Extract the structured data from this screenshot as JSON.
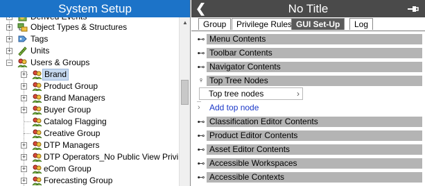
{
  "left_panel": {
    "title": "System Setup",
    "tree": [
      {
        "label": "Derived Events",
        "icon": "derived-events-icon"
      },
      {
        "label": "Object Types & Structures",
        "icon": "object-types-icon"
      },
      {
        "label": "Tags",
        "icon": "tag-icon"
      },
      {
        "label": "Units",
        "icon": "ruler-icon"
      },
      {
        "label": "Users & Groups",
        "icon": "users-icon"
      },
      {
        "label": "Brand",
        "icon": "users-icon"
      },
      {
        "label": "Product Group",
        "icon": "users-icon"
      },
      {
        "label": "Brand Managers",
        "icon": "users-icon"
      },
      {
        "label": "Buyer Group",
        "icon": "users-icon"
      },
      {
        "label": "Catalog Flagging",
        "icon": "users-icon"
      },
      {
        "label": "Creative Group",
        "icon": "users-icon"
      },
      {
        "label": "DTP Managers",
        "icon": "users-icon"
      },
      {
        "label": "DTP Operators_No Public View Privileges",
        "icon": "users-icon"
      },
      {
        "label": "eCom Group",
        "icon": "users-icon"
      },
      {
        "label": "Forecasting Group",
        "icon": "users-icon"
      }
    ],
    "selected": "Brand"
  },
  "right_panel": {
    "title": "No Title",
    "back_icon": "back-arrow-icon",
    "pin_icon": "pin-icon",
    "tabs": [
      {
        "label": "Group"
      },
      {
        "label": "Privilege Rules"
      },
      {
        "label": "GUI Set-Up"
      },
      {
        "label": "Log"
      }
    ],
    "active_tab": "GUI Set-Up",
    "sections": [
      {
        "label": "Menu Contents"
      },
      {
        "label": "Toolbar Contents"
      },
      {
        "label": "Navigator Contents"
      },
      {
        "label": "Top Tree Nodes"
      },
      {
        "label": "Classification Editor Contents"
      },
      {
        "label": "Product Editor Contents"
      },
      {
        "label": "Asset Editor Contents"
      },
      {
        "label": "Accessible Workspaces"
      },
      {
        "label": "Accessible Contexts"
      }
    ],
    "top_tree_nodes": {
      "item_label": "Top tree nodes",
      "add_label": "Add top node"
    }
  },
  "colors": {
    "left_title_bg": "#1c73c8",
    "right_title_bg": "#4a4a4a",
    "section_bar": "#b4b4b4",
    "selection": "#c6d9f0",
    "add_link": "#1a37c8"
  }
}
